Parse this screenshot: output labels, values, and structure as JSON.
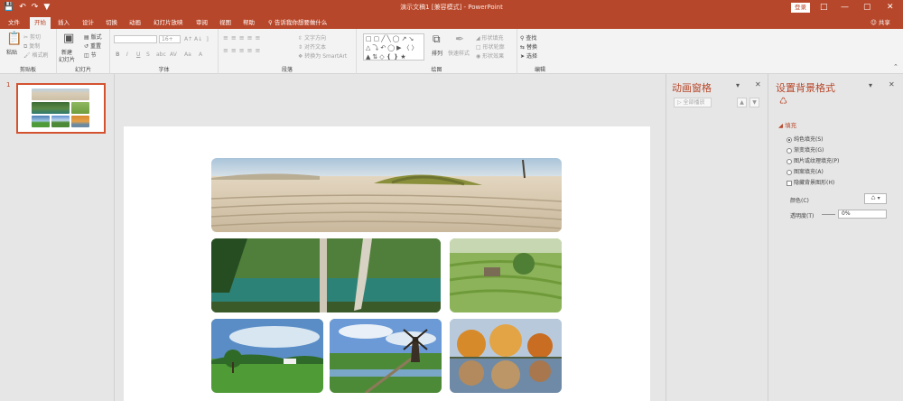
{
  "window": {
    "title": "演示文稿1 [兼容模式] - PowerPoint",
    "login_label": "登录"
  },
  "quick_access": {
    "save_icon": "save-icon",
    "undo_icon": "undo-icon",
    "redo_icon": "redo-icon",
    "customize_icon": "customize-icon"
  },
  "tabs": [
    {
      "label": "文件"
    },
    {
      "label": "开始"
    },
    {
      "label": "插入"
    },
    {
      "label": "设计"
    },
    {
      "label": "切换"
    },
    {
      "label": "动画"
    },
    {
      "label": "幻灯片放映"
    },
    {
      "label": "审阅"
    },
    {
      "label": "视图"
    },
    {
      "label": "帮助"
    }
  ],
  "tell_me": "告诉我你想要做什么",
  "share_label": "共享",
  "ribbon": {
    "clipboard": {
      "label": "剪贴板",
      "paste": "粘贴",
      "cut": "剪切",
      "copy": "复制",
      "format_painter": "格式刷"
    },
    "slides": {
      "label": "幻灯片",
      "new_slide": "新建",
      "new_slide_2": "幻灯片",
      "layout": "版式",
      "reset": "重置",
      "section": "节"
    },
    "font": {
      "label": "字体",
      "size_value": "16+",
      "bold": "B",
      "italic": "I",
      "underline": "U",
      "strike": "S",
      "shadow": "abc",
      "spacing": "AV",
      "case": "Aa",
      "color": "A"
    },
    "paragraph": {
      "label": "段落",
      "text_direction": "文字方向",
      "align_text": "对齐文本",
      "smartart": "转换为 SmartArt"
    },
    "drawing": {
      "label": "绘图",
      "arrange": "排列",
      "quick_styles": "快速样式",
      "shape_fill": "形状填充",
      "shape_outline": "形状轮廓",
      "shape_effects": "形状效果"
    },
    "editing": {
      "label": "编辑",
      "find": "查找",
      "replace": "替换",
      "select": "选择"
    }
  },
  "thumbnail": {
    "number": "1"
  },
  "animation_pane": {
    "title": "动画窗格",
    "play_all": "全部播放"
  },
  "format_pane": {
    "title": "设置背景格式",
    "fill_header": "填充",
    "options": [
      {
        "label": "纯色填充(S)",
        "selected": true
      },
      {
        "label": "渐变填充(G)",
        "selected": false
      },
      {
        "label": "图片或纹理填充(P)",
        "selected": false
      },
      {
        "label": "图案填充(A)",
        "selected": false
      }
    ],
    "hide_graphics": "隐藏背景图形(H)",
    "color_label": "颜色(C)",
    "transparency_label": "透明度(T)",
    "transparency_value": "0%"
  },
  "colors": {
    "accent": "#b7472a",
    "selection_border": "#d35230",
    "ribbon_bg": "#f3f3f3",
    "pane_bg": "#e6e6e6"
  }
}
